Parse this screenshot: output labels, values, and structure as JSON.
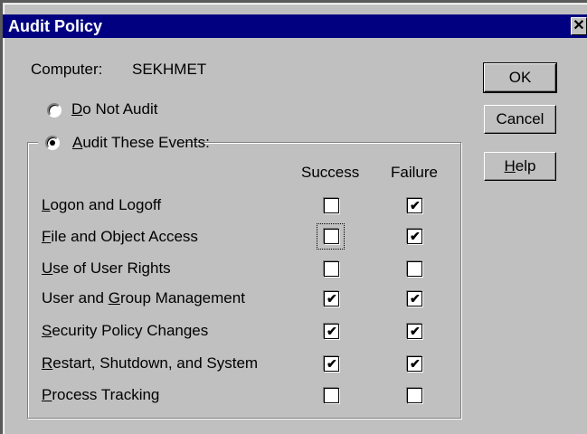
{
  "dialog": {
    "title": "Audit Policy",
    "close_glyph": "✕"
  },
  "computer": {
    "label": "Computer:",
    "name": "SEKHMET"
  },
  "options": {
    "do_not_audit": {
      "mnemonic": "D",
      "rest": "o Not Audit",
      "selected": false
    },
    "audit_these": {
      "mnemonic": "A",
      "rest": "udit These Events:",
      "selected": true
    }
  },
  "columns": {
    "success": "Success",
    "failure": "Failure"
  },
  "events": [
    {
      "mnemonic": "L",
      "rest": "ogon and Logoff",
      "success": false,
      "failure": true
    },
    {
      "mnemonic": "F",
      "rest": "ile and Object Access",
      "success": false,
      "failure": true,
      "focused": "success"
    },
    {
      "mnemonic": "U",
      "rest": "se of User Rights",
      "success": false,
      "failure": false
    },
    {
      "before": "User and ",
      "mnemonic": "G",
      "rest": "roup Management",
      "success": true,
      "failure": true
    },
    {
      "mnemonic": "S",
      "rest": "ecurity Policy Changes",
      "success": true,
      "failure": true
    },
    {
      "mnemonic": "R",
      "rest": "estart, Shutdown, and System",
      "success": true,
      "failure": true
    },
    {
      "mnemonic": "P",
      "rest": "rocess Tracking",
      "success": false,
      "failure": false
    }
  ],
  "buttons": {
    "ok": "OK",
    "cancel": "Cancel",
    "help_mnemonic": "H",
    "help_rest": "elp"
  },
  "colors": {
    "titlebar": "#000080",
    "face": "#c0c0c0",
    "backdrop": "#5a5a5a"
  }
}
